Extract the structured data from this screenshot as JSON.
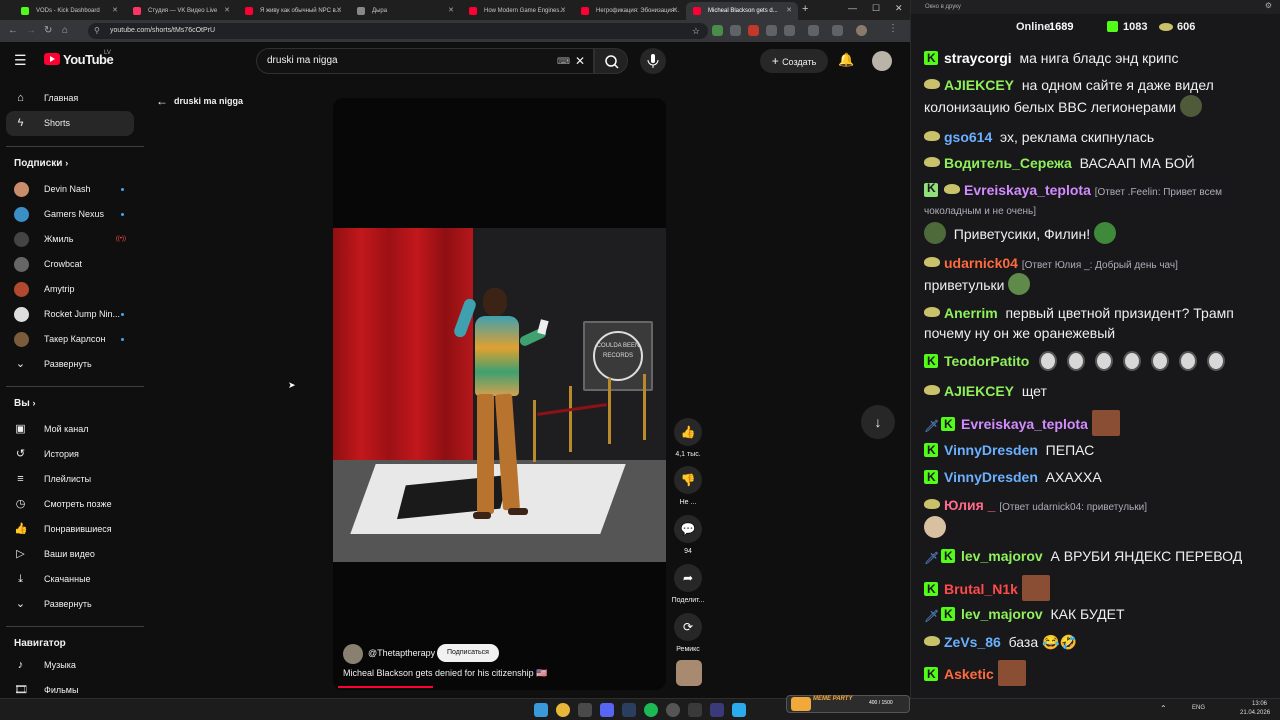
{
  "browser": {
    "tabs": [
      {
        "label": "VODs - Kick Dashboard",
        "color": "#53fc18"
      },
      {
        "label": "Студия — VK Видео Live",
        "color": "#ff3366"
      },
      {
        "label": "Я живу как обычный NPC в...",
        "color": "#ff0033"
      },
      {
        "label": "Дыра",
        "color": "#888888"
      },
      {
        "label": "How Modern Game Engines...",
        "color": "#ff0033"
      },
      {
        "label": "Негрофикация: Эбонизация...",
        "color": "#ff0033"
      },
      {
        "label": "Micheal Blackson gets d...",
        "color": "#ff0033"
      }
    ],
    "url": "youtube.com/shorts/tMs76cOtPrU"
  },
  "yt": {
    "logo_text": "YouTube",
    "logo_region": "LV",
    "search_value": "druski ma nigga",
    "create_label": "Создать",
    "back_title": "druski ma nigga"
  },
  "sidebar": {
    "main": [
      {
        "label": "Главная",
        "icon": "home-icon"
      },
      {
        "label": "Shorts",
        "icon": "shorts-icon"
      }
    ],
    "subs_heading": "Подписки",
    "subs": [
      {
        "label": "Devin Nash",
        "color": "#c98d6b",
        "dot": true
      },
      {
        "label": "Gamers Nexus",
        "color": "#3a8fc7",
        "dot": true
      },
      {
        "label": "Жмиль",
        "color": "#444444",
        "live": "((•))"
      },
      {
        "label": "Crowbcat",
        "color": "#666666",
        "dot": false
      },
      {
        "label": "Amytrip",
        "color": "#b0492f",
        "dot": false
      },
      {
        "label": "Rocket Jump Nin...",
        "color": "#dddddd",
        "dot": true
      },
      {
        "label": "Такер Карлсон",
        "color": "#7a5b3a",
        "dot": true
      }
    ],
    "expand_label": "Развернуть",
    "you_heading": "Вы",
    "you": [
      {
        "label": "Мой канал",
        "icon": "channel-icon"
      },
      {
        "label": "История",
        "icon": "history-icon"
      },
      {
        "label": "Плейлисты",
        "icon": "playlists-icon"
      },
      {
        "label": "Смотреть позже",
        "icon": "watch-later-icon"
      },
      {
        "label": "Понравившиеся",
        "icon": "like-icon"
      },
      {
        "label": "Ваши видео",
        "icon": "your-videos-icon"
      },
      {
        "label": "Скачанные",
        "icon": "downloads-icon"
      }
    ],
    "expand_label2": "Развернуть",
    "nav_heading": "Навигатор",
    "nav": [
      {
        "label": "Музыка",
        "icon": "music-icon"
      },
      {
        "label": "Фильмы",
        "icon": "movies-icon"
      }
    ]
  },
  "short": {
    "channel": "@Thetaptherapy",
    "subscribe_label": "Подписаться",
    "title": "Micheal Blackson gets denied for his citizenship 🇺🇸",
    "sign_text": "COULDA BEEN RECORDS",
    "likes": "4,1 тыс.",
    "dislike": "Не ...",
    "comments": "94",
    "share": "Поделит...",
    "remix": "Ремикс"
  },
  "chat": {
    "window_title": "Окно в друку",
    "online_label": "Online:",
    "online_value": "1689",
    "kick_count": "1083",
    "vk_count": "606",
    "messages": [
      {
        "user": "straycorgi",
        "color": "#ffffff",
        "text": "ма нига бладс энд крипс"
      },
      {
        "user": "AJIEKCEY",
        "color": "#8ff05a",
        "text": "на одном сайте я даже видел колонизацию белых BBC легионерами"
      },
      {
        "user": "gso614",
        "color": "#6ab0ff",
        "text": "эх, реклама скипнулась"
      },
      {
        "user": "Водитель_Сережа",
        "color": "#8ff05a",
        "text": "ВАСААП МА БОЙ"
      },
      {
        "user": "Evreiskaya_teplota",
        "color": "#d38cff",
        "reply": "[Ответ .Feelin: Привет всем чоколадным и не очень]",
        "text": "Приветусики, Филин!"
      },
      {
        "user": "udarnick04",
        "color": "#ff6a3d",
        "reply": "[Ответ Юлия _: Добрый день чач]",
        "text": "приветульки"
      },
      {
        "user": "Anerrim",
        "color": "#8ff05a",
        "text": "первый цветной призидент? Трамп почему ну он же оранежевый"
      },
      {
        "user": "TeodorPatito",
        "color": "#8ff05a",
        "text": ""
      },
      {
        "user": "AJIEKCEY",
        "color": "#8ff05a",
        "text": "щет"
      },
      {
        "user": "Evreiskaya_teplota",
        "color": "#d38cff",
        "text": ""
      },
      {
        "user": "VinnyDresden",
        "color": "#6ab0ff",
        "text": "ПЕПАС"
      },
      {
        "user": "VinnyDresden",
        "color": "#6ab0ff",
        "text": "АХАХХА"
      },
      {
        "user": "Юлия _",
        "color": "#ff6a8a",
        "reply": "[Ответ udarnick04: приветульки]",
        "text": ""
      },
      {
        "user": "lev_majorov",
        "color": "#8ff05a",
        "text": "А ВРУБИ ЯНДЕКС ПЕРЕВОД"
      },
      {
        "user": "Brutal_N1k",
        "color": "#ff4a4a",
        "text": ""
      },
      {
        "user": "lev_majorov",
        "color": "#8ff05a",
        "text": "КАК БУДЕТ"
      },
      {
        "user": "ZeVs_86",
        "color": "#6ab0ff",
        "text": "база 😂🤣"
      },
      {
        "user": "Asketic",
        "color": "#ff6a3d",
        "text": ""
      }
    ]
  },
  "taskbar": {
    "lang": "ENG",
    "time": "13:06",
    "date": "21.04.2026",
    "widget": "400 / 1500",
    "widget_label": "MEME PARTY"
  }
}
